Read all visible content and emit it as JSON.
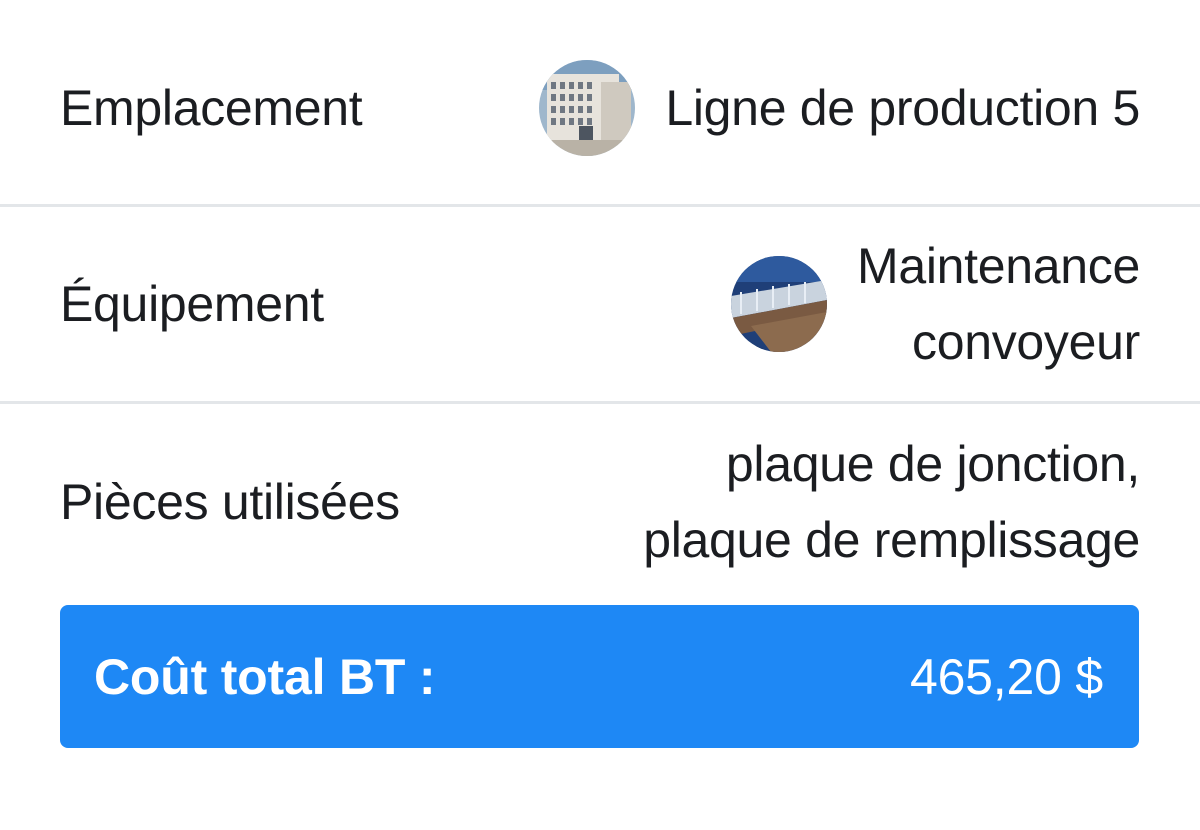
{
  "rows": [
    {
      "label": "Emplacement",
      "avatar": "building-photo",
      "value_lines": [
        "Ligne de production 5"
      ]
    },
    {
      "label": "Équipement",
      "avatar": "conveyor-photo",
      "value_lines": [
        "Maintenance",
        "convoyeur"
      ]
    },
    {
      "label": "Pièces utilisées",
      "value_lines": [
        "plaque de jonction,",
        "plaque de remplissage"
      ]
    }
  ],
  "total": {
    "label": "Coût total BT :",
    "value": "465,20 $"
  },
  "colors": {
    "accent": "#1e88f5",
    "divider": "#e3e6e9",
    "text": "#1b1d21"
  }
}
